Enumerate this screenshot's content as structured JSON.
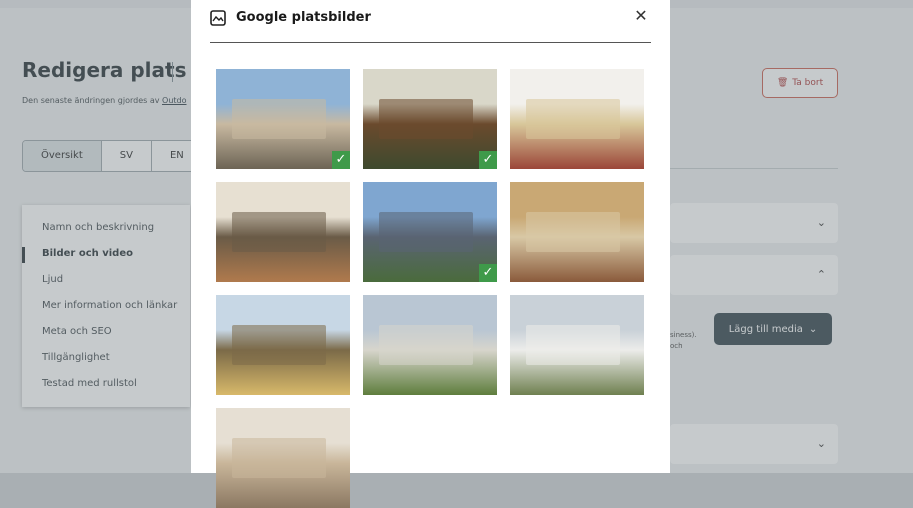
{
  "background": {
    "title": "Redigera plats",
    "subtitle_prefix": "Den senaste ändringen gjordes av ",
    "subtitle_link": "Outdo",
    "tabs": [
      "Översikt",
      "SV",
      "EN"
    ],
    "delete_label": "Ta bort",
    "nav_items": [
      "Namn och beskrivning",
      "Bilder och video",
      "Ljud",
      "Mer information och länkar",
      "Meta och SEO",
      "Tillgänglighet",
      "Testad med rullstol"
    ],
    "fragment_line1": "siness).",
    "fragment_line2": "och",
    "add_media_label": "Lägg till media"
  },
  "modal": {
    "title": "Google platsbilder",
    "close_label": "✕",
    "images": [
      {
        "subject": "terrace with snow and tables",
        "selected": true,
        "colors": [
          "#8fb3d6",
          "#6d6455",
          "#c8b9a1"
        ]
      },
      {
        "subject": "wooden deck by the lake",
        "selected": true,
        "colors": [
          "#d9d7c9",
          "#3e4a2e",
          "#6b4a2d"
        ]
      },
      {
        "subject": "plated dish with tomatoes",
        "selected": false,
        "colors": [
          "#f2f0ec",
          "#9b4638",
          "#d8c79a"
        ]
      },
      {
        "subject": "buffet table spread",
        "selected": false,
        "colors": [
          "#e7e0d2",
          "#b07a4d",
          "#6a5b47"
        ]
      },
      {
        "subject": "manor with lawn and flag",
        "selected": true,
        "colors": [
          "#7fa6d0",
          "#4a6b3c",
          "#5a6472"
        ]
      },
      {
        "subject": "hotel room with bed",
        "selected": false,
        "colors": [
          "#c9a874",
          "#8a5a3b",
          "#d8c8a5"
        ]
      },
      {
        "subject": "yellow villa veranda",
        "selected": false,
        "colors": [
          "#c7d7e5",
          "#d8b96a",
          "#7b6a48"
        ]
      },
      {
        "subject": "white manor and lawn",
        "selected": false,
        "colors": [
          "#b9c6d3",
          "#5e7d3d",
          "#d7d5cc"
        ]
      },
      {
        "subject": "white manor in park",
        "selected": false,
        "colors": [
          "#c9d1d8",
          "#6f8050",
          "#ececea"
        ]
      },
      {
        "subject": "dining hall interior",
        "selected": false,
        "colors": [
          "#e6dfd3",
          "#8b7862",
          "#c9b69a"
        ]
      }
    ]
  }
}
